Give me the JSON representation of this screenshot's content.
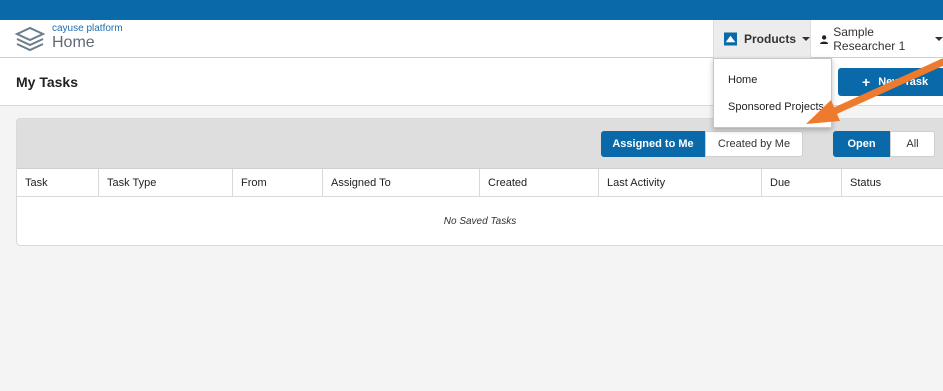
{
  "brand": {
    "sub": "cayuse platform",
    "main": "Home"
  },
  "header": {
    "products_label": "Products",
    "user_label": "Sample Researcher 1"
  },
  "page": {
    "title": "My Tasks",
    "new_task_label": "New Task"
  },
  "filters": {
    "assigned_to_me": "Assigned to Me",
    "created_by_me": "Created by Me",
    "open": "Open",
    "all": "All"
  },
  "table": {
    "columns": [
      "Task",
      "Task Type",
      "From",
      "Assigned To",
      "Created",
      "Last Activity",
      "Due",
      "Status"
    ],
    "empty_message": "No Saved Tasks"
  },
  "products_menu": {
    "items": [
      "Home",
      "Sponsored Projects"
    ]
  },
  "colors": {
    "primary": "#0a6aa9",
    "annotation_arrow": "#ee7b2d"
  },
  "icons": [
    "cayuse-logo-icon",
    "products-icon",
    "caret-down-icon",
    "user-icon",
    "plus-icon"
  ]
}
